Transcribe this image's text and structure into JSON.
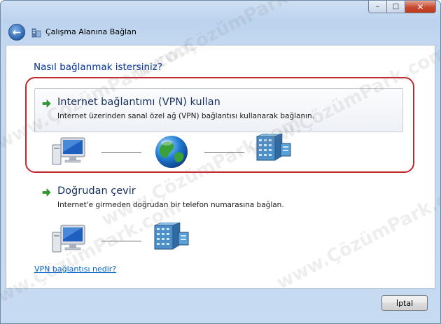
{
  "window": {
    "title": "Çalışma Alanına Bağlan",
    "minimize_glyph": "–",
    "maximize_glyph": "□",
    "close_glyph": "✕"
  },
  "page": {
    "question": "Nasıl bağlanmak istersiniz?"
  },
  "options": [
    {
      "title": "Internet bağlantımı (VPN) kullan",
      "description": "Internet üzerinden sanal özel ağ (VPN) bağlantısı kullanarak bağlanın."
    },
    {
      "title": "Doğrudan çevir",
      "description": "Internet'e girmeden doğrudan bir telefon numarasına bağlan."
    }
  ],
  "help_link": "VPN bağlantısı nedir?",
  "buttons": {
    "cancel": "İptal"
  },
  "watermark": "www.ÇözümPark.com",
  "colors": {
    "question": "#003399",
    "link": "#0066cc",
    "highlight_border": "#c4262e",
    "arrow": "#2ca02c"
  }
}
